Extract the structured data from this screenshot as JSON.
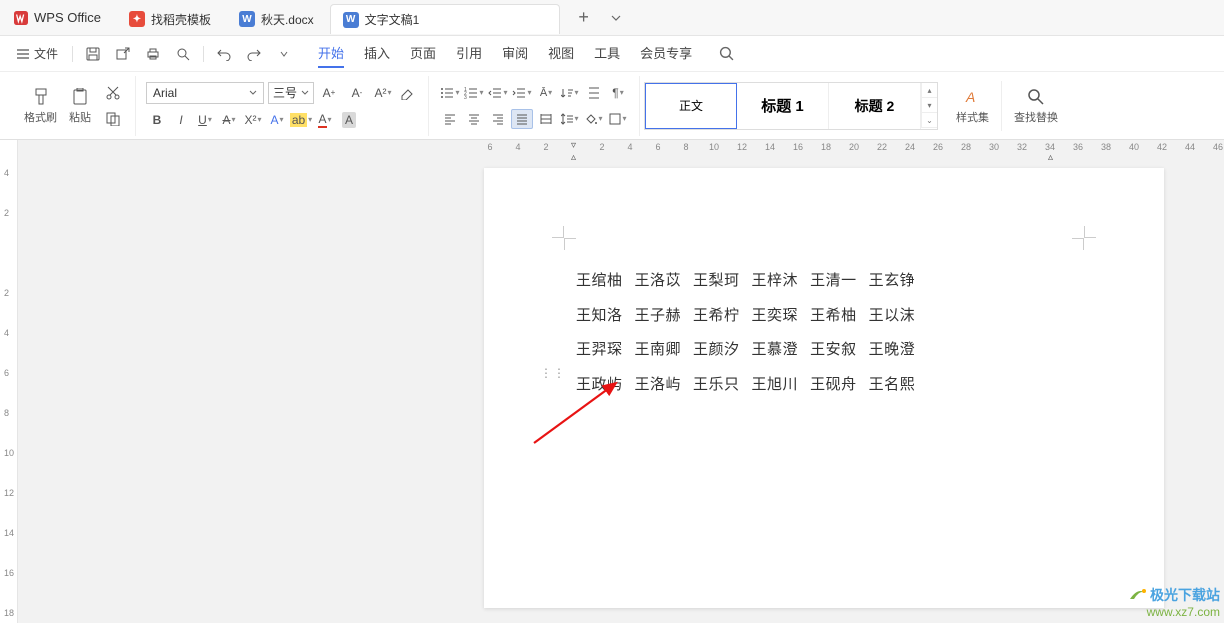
{
  "titlebar": {
    "app_name": "WPS Office",
    "tabs": [
      {
        "label": "找稻壳模板",
        "icon": "red"
      },
      {
        "label": "秋天.docx",
        "icon": "blue"
      },
      {
        "label": "文字文稿1",
        "icon": "blue",
        "active": true
      }
    ]
  },
  "menubar": {
    "file_label": "文件",
    "tabs": [
      "开始",
      "插入",
      "页面",
      "引用",
      "审阅",
      "视图",
      "工具",
      "会员专享"
    ],
    "active": "开始"
  },
  "ribbon": {
    "format_painter": "格式刷",
    "paste": "粘贴",
    "font_name": "Arial",
    "font_size": "三号",
    "styles": {
      "body": "正文",
      "h1": "标题 1",
      "h2": "标题 2"
    },
    "style_set": "样式集",
    "find_replace": "查找替换"
  },
  "ruler": {
    "h": [
      "6",
      "4",
      "2",
      "",
      "2",
      "4",
      "6",
      "8",
      "10",
      "12",
      "14",
      "16",
      "18",
      "20",
      "22",
      "24",
      "26",
      "28",
      "30",
      "32",
      "34",
      "36",
      "38",
      "40",
      "42",
      "44",
      "46"
    ],
    "v": [
      "4",
      "2",
      "",
      "2",
      "4",
      "6",
      "8",
      "10",
      "12",
      "14",
      "16",
      "18"
    ]
  },
  "document": {
    "lines": [
      [
        "王绾柚",
        "王洛苡",
        "王梨珂",
        "王梓沐",
        "王清一",
        "王玄铮"
      ],
      [
        "王知洛",
        "王子赫",
        "王希柠",
        "王奕琛",
        "王希柚",
        "王以沫"
      ],
      [
        "王羿琛",
        "王南卿",
        "王颜汐",
        "王慕澄",
        "王安叙",
        "王晚澄"
      ],
      [
        "王政屿",
        "王洛屿",
        "王乐只",
        "王旭川",
        "王砚舟",
        "王名熙"
      ]
    ]
  },
  "watermark": {
    "line1": "极光下载站",
    "line2": "www.xz7.com"
  }
}
